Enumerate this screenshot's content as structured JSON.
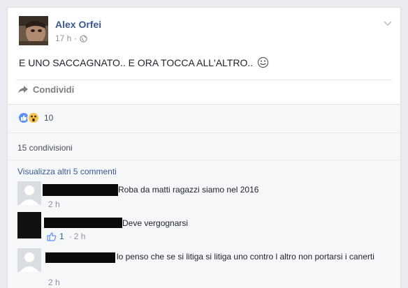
{
  "post": {
    "author": "Alex Orfei",
    "time": "17 h",
    "dot": "·",
    "text": "E UNO SACCAGNATO.. E ORA TOCCA ALL'ALTRO..",
    "share_label": "Condividi"
  },
  "stats": {
    "reaction_count": "10",
    "shares": "15 condivisioni",
    "more_comments": "Visualizza altri 5 commenti"
  },
  "comments": [
    {
      "text": "Roba da matti ragazzi siamo nel 2016",
      "time": "2 h"
    },
    {
      "text": "Deve vergognarsi",
      "likes": "1",
      "dot": "·",
      "time": "2 h"
    },
    {
      "text": "lo penso che se si litiga si litiga uno contro l altro non portarsi i canerti",
      "time": "2 h"
    }
  ],
  "colors": {
    "link": "#365899",
    "like_blue": "#5890ff",
    "wow_yellow": "#f7c64a"
  }
}
